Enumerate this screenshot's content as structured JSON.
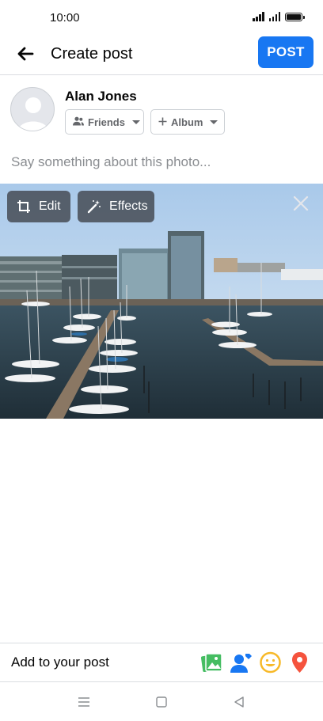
{
  "status_bar": {
    "time": "10:00"
  },
  "header": {
    "title": "Create post",
    "post_label": "POST"
  },
  "author": {
    "name": "Alan Jones",
    "audience_label": "Friends",
    "album_label": "Album"
  },
  "composer": {
    "placeholder": "Say something about this photo..."
  },
  "photo": {
    "edit_label": "Edit",
    "effects_label": "Effects"
  },
  "add_to_post": {
    "label": "Add to your post",
    "icons": [
      "photo-icon",
      "tag-people-icon",
      "feeling-icon",
      "location-icon"
    ]
  },
  "colors": {
    "primary": "#1877f2",
    "photo_green": "#45bd62",
    "tag_blue": "#1877f2",
    "feeling_yellow": "#f7b928",
    "location_red": "#f5533d"
  }
}
